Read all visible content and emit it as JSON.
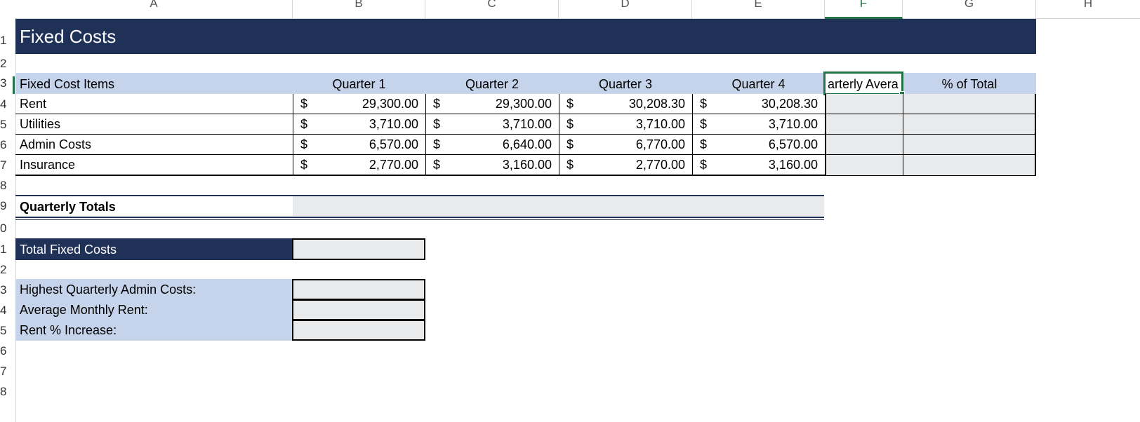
{
  "columns": [
    "A",
    "B",
    "C",
    "D",
    "E",
    "F",
    "G",
    "H"
  ],
  "rows": [
    "1",
    "2",
    "3",
    "4",
    "5",
    "6",
    "7",
    "8",
    "9",
    "0",
    "1",
    "2",
    "3",
    "4",
    "5",
    "6",
    "7",
    "8"
  ],
  "sheet": {
    "title": "Fixed Costs",
    "header": {
      "items": "Fixed Cost Items",
      "q1": "Quarter 1",
      "q2": "Quarter 2",
      "q3": "Quarter 3",
      "q4": "Quarter 4",
      "avg": "arterly Avera",
      "pct": "% of Total"
    },
    "currency": "$",
    "items": [
      {
        "label": "Rent",
        "q": [
          "29,300.00",
          "29,300.00",
          "30,208.30",
          "30,208.30"
        ]
      },
      {
        "label": "Utilities",
        "q": [
          "3,710.00",
          "3,710.00",
          "3,710.00",
          "3,710.00"
        ]
      },
      {
        "label": "Admin Costs",
        "q": [
          "6,570.00",
          "6,640.00",
          "6,770.00",
          "6,570.00"
        ]
      },
      {
        "label": "Insurance",
        "q": [
          "2,770.00",
          "3,160.00",
          "2,770.00",
          "3,160.00"
        ]
      }
    ],
    "quarterly_totals": "Quarterly Totals",
    "total_fixed": "Total Fixed Costs",
    "highest_admin": "Highest Quarterly Admin Costs:",
    "avg_monthly_rent": "Average Monthly Rent:",
    "rent_increase": "Rent % Increase:"
  },
  "selected_column": "F",
  "selected_row": "3"
}
